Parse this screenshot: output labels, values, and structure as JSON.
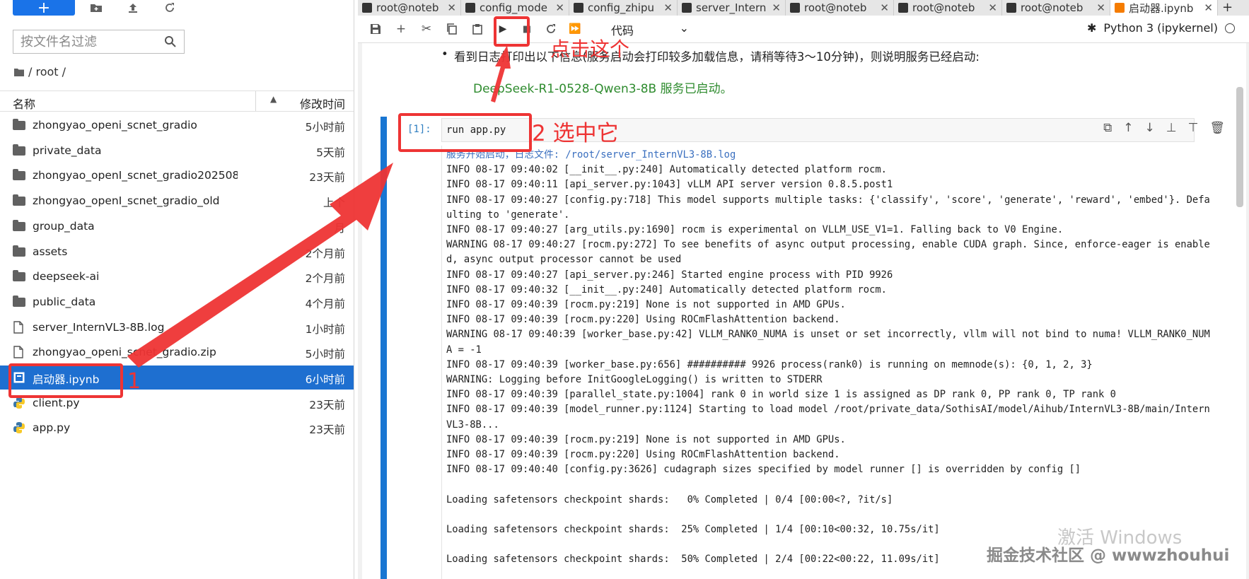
{
  "left_panel": {
    "new_button_label": "+",
    "filter_placeholder": "按文件名过滤",
    "breadcrumb": "/ root /",
    "columns": {
      "name": "名称",
      "modified": "修改时间"
    },
    "files": [
      {
        "name": "zhongyao_openi_scnet_gradio",
        "modified": "5小时前",
        "kind": "folder"
      },
      {
        "name": "private_data",
        "modified": "5天前",
        "kind": "folder"
      },
      {
        "name": "zhongyao_openI_scnet_gradio202508...",
        "modified": "23天前",
        "kind": "folder"
      },
      {
        "name": "zhongyao_openI_scnet_gradio_old",
        "modified": "上个",
        "kind": "folder"
      },
      {
        "name": "group_data",
        "modified": "月",
        "kind": "folder"
      },
      {
        "name": "assets",
        "modified": "2个月前",
        "kind": "folder"
      },
      {
        "name": "deepseek-ai",
        "modified": "2个月前",
        "kind": "folder"
      },
      {
        "name": "public_data",
        "modified": "4个月前",
        "kind": "folder"
      },
      {
        "name": "server_InternVL3-8B.log",
        "modified": "1小时前",
        "kind": "file"
      },
      {
        "name": "zhongyao_openi_scnet_gradio.zip",
        "modified": "5小时前",
        "kind": "file"
      },
      {
        "name": "启动器.ipynb",
        "modified": "6小时前",
        "kind": "notebook",
        "selected": true
      },
      {
        "name": "client.py",
        "modified": "23天前",
        "kind": "python"
      },
      {
        "name": "app.py",
        "modified": "23天前",
        "kind": "python"
      }
    ]
  },
  "tabs": [
    {
      "label": "root@noteb",
      "icon": "terminal-icon"
    },
    {
      "label": "config_mode",
      "icon": "file-icon"
    },
    {
      "label": "config_zhipu",
      "icon": "file-icon"
    },
    {
      "label": "server_Intern",
      "icon": "file-icon"
    },
    {
      "label": "root@noteb",
      "icon": "terminal-icon"
    },
    {
      "label": "root@noteb",
      "icon": "terminal-icon"
    },
    {
      "label": "root@noteb",
      "icon": "terminal-icon"
    },
    {
      "label": "启动器.ipynb",
      "icon": "notebook-icon",
      "active": true
    }
  ],
  "toolbar": {
    "cell_type": "代码",
    "kernel": "Python 3 (ipykernel)"
  },
  "notebook": {
    "md_text": "看到日志打印出以下信息(服务启动会打印较多加载信息，请稍等待3～10分钟)，则说明服务已经启动:",
    "md_green": "DeepSeek-R1-0528-Qwen3-8B 服务已启动。",
    "prompt": "[1]:",
    "code": "run app.py",
    "output_lines": [
      "服务开始启动，日志文件: /root/server_InternVL3-8B.log",
      "INFO 08-17 09:40:02 [__init__.py:240] Automatically detected platform rocm.",
      "INFO 08-17 09:40:11 [api_server.py:1043] vLLM API server version 0.8.5.post1",
      "INFO 08-17 09:40:27 [config.py:718] This model supports multiple tasks: {'classify', 'score', 'generate', 'reward', 'embed'}. Defaulting to 'generate'.",
      "INFO 08-17 09:40:27 [arg_utils.py:1690] rocm is experimental on VLLM_USE_V1=1. Falling back to V0 Engine.",
      "WARNING 08-17 09:40:27 [rocm.py:272] To see benefits of async output processing, enable CUDA graph. Since, enforce-eager is enabled, async output processor cannot be used",
      "INFO 08-17 09:40:27 [api_server.py:246] Started engine process with PID 9926",
      "INFO 08-17 09:40:32 [__init__.py:240] Automatically detected platform rocm.",
      "INFO 08-17 09:40:39 [rocm.py:219] None is not supported in AMD GPUs.",
      "INFO 08-17 09:40:39 [rocm.py:220] Using ROCmFlashAttention backend.",
      "WARNING 08-17 09:40:39 [worker_base.py:42] VLLM_RANK0_NUMA is unset or set incorrectly, vllm will not bind to numa! VLLM_RANK0_NUMA = -1",
      "INFO 08-17 09:40:39 [worker_base.py:656] ########## 9926 process(rank0) is running on memnode(s): {0, 1, 2, 3}",
      "WARNING: Logging before InitGoogleLogging() is written to STDERR",
      "INFO 08-17 09:40:39 [parallel_state.py:1004] rank 0 in world size 1 is assigned as DP rank 0, PP rank 0, TP rank 0",
      "INFO 08-17 09:40:39 [model_runner.py:1124] Starting to load model /root/private_data/SothisAI/model/Aihub/InternVL3-8B/main/InternVL3-8B...",
      "INFO 08-17 09:40:39 [rocm.py:219] None is not supported in AMD GPUs.",
      "INFO 08-17 09:40:39 [rocm.py:220] Using ROCmFlashAttention backend.",
      "INFO 08-17 09:40:40 [config.py:3626] cudagraph sizes specified by model runner [] is overridden by config []",
      "",
      "Loading safetensors checkpoint shards:   0% Completed | 0/4 [00:00<?, ?it/s]",
      "",
      "Loading safetensors checkpoint shards:  25% Completed | 1/4 [00:10<00:32, 10.75s/it]",
      "",
      "Loading safetensors checkpoint shards:  50% Completed | 2/4 [00:22<00:22, 11.09s/it]"
    ]
  },
  "annotations": {
    "step1": "1",
    "step2": "2 选中它",
    "click_here": "点击这个"
  },
  "watermark": {
    "windows": "激活 Windows",
    "site": "掘金技术社区 @ wwwzhouhui"
  },
  "colors": {
    "accent": "#1e6fd0",
    "annotation": "#ee3434",
    "green_text": "#2e8b2e"
  }
}
